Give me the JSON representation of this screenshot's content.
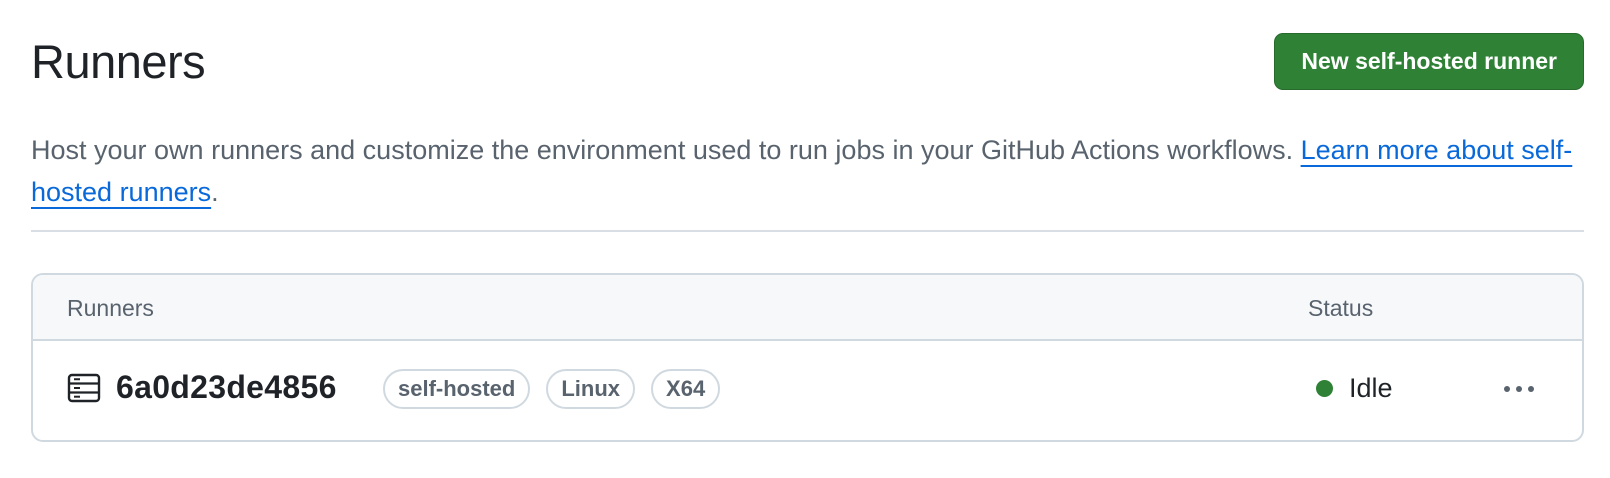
{
  "header": {
    "title": "Runners",
    "new_runner_button": "New self-hosted runner"
  },
  "description": {
    "text": "Host your own runners and customize the environment used to run jobs in your GitHub Actions workflows. ",
    "link_text": "Learn more about self-hosted runners",
    "trailing": "."
  },
  "table": {
    "columns": [
      "Runners",
      "Status"
    ],
    "rows": [
      {
        "icon": "server-icon",
        "name": "6a0d23de4856",
        "labels": [
          "self-hosted",
          "Linux",
          "X64"
        ],
        "status": "Idle",
        "status_color": "#2f8136",
        "menu_icon": "kebab-horizontal-icon"
      }
    ]
  },
  "colors": {
    "primary_button": "#2f8136",
    "link": "#0969da",
    "muted_text": "#59636e",
    "border": "#d1d9e0"
  }
}
